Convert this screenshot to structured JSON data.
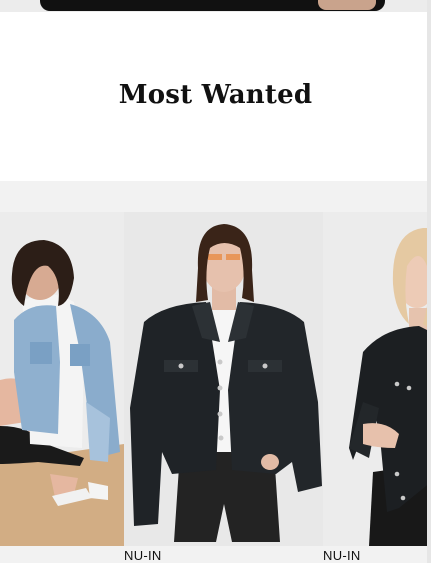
{
  "section": {
    "title": "Most Wanted"
  },
  "products": [
    {
      "brand": "",
      "image_alt": "model crouching in light denim jacket and white hoodie"
    },
    {
      "brand": "NU-IN",
      "image_alt": "model in black denim jacket and black denim shorts"
    },
    {
      "brand": "NU-IN",
      "image_alt": "blonde model in black cropped denim jacket"
    }
  ],
  "colors": {
    "background": "#ffffff",
    "carousel_background": "#f2f2f2",
    "text": "#111111",
    "black_denim": "#1e2226",
    "light_denim": "#8fb0cf"
  }
}
